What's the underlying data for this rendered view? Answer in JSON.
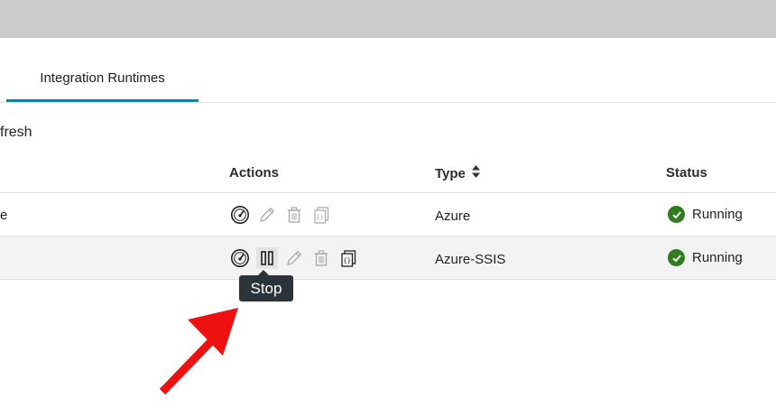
{
  "tabs": [
    {
      "label": "Integration Runtimes",
      "active": true
    }
  ],
  "toolbar": {
    "refresh_label": "fresh"
  },
  "table": {
    "columns": {
      "actions": "Actions",
      "type": "Type",
      "status": "Status"
    },
    "rows": [
      {
        "name": "e",
        "type": "Azure",
        "status": "Running"
      },
      {
        "name": "",
        "type": "Azure-SSIS",
        "status": "Running"
      }
    ]
  },
  "tooltip": {
    "label": "Stop"
  },
  "icons": {
    "monitor": "gauge-icon",
    "stop": "pause-icon",
    "edit": "pencil-icon",
    "delete": "trash-icon",
    "code": "code-icon",
    "status": "check-circle-icon",
    "sort": "sort-icon",
    "annotation": "red-arrow"
  },
  "colors": {
    "tab_accent": "#1e7e9a",
    "status_ok": "#2f7d1e",
    "arrow": "#ee1111",
    "tooltip_bg": "#2c343b"
  }
}
